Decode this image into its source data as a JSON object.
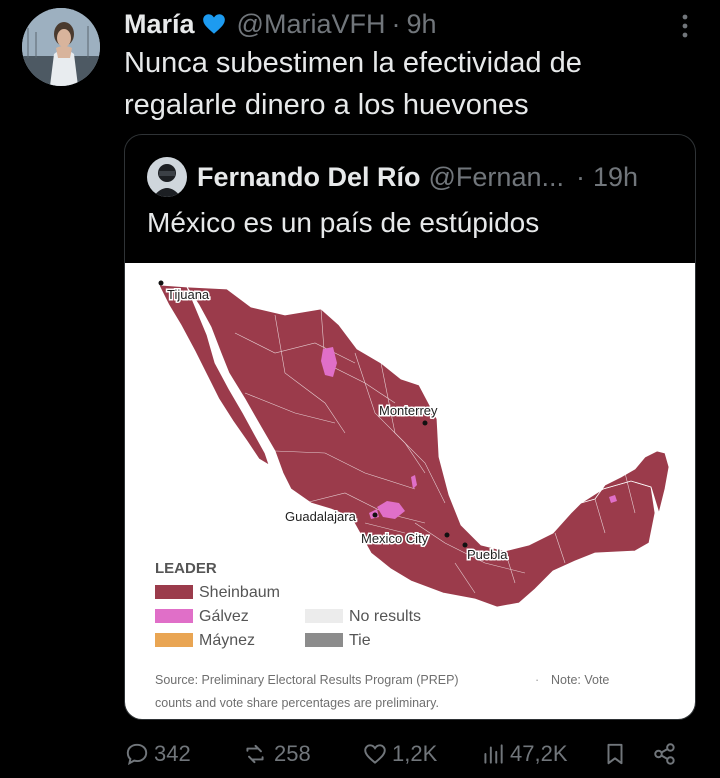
{
  "tweet": {
    "name": "María",
    "handle": "@MariaVFH",
    "separator": "·",
    "time": "9h",
    "text": "Nunca subestimen la efectividad de regalarle dinero a los huevones"
  },
  "quote": {
    "name": "Fernando Del Río",
    "handle": "@Fernan...",
    "separator": "·",
    "time": "19h",
    "text": "México es un país de estúpidos"
  },
  "map": {
    "cities": {
      "tijuana": "Tijuana",
      "monterrey": "Monterrey",
      "guadalajara": "Guadalajara",
      "mexico_city": "Mexico City",
      "puebla": "Puebla"
    },
    "legend": {
      "title": "LEADER",
      "sheinbaum": "Sheinbaum",
      "galvez": "Gálvez",
      "maynez": "Máynez",
      "no_results": "No results",
      "tie": "Tie"
    },
    "source_line1": "Source: Preliminary Electoral Results Program (PREP)",
    "bullet": "·",
    "note_line1": "Note: Vote",
    "source_line2": "counts and vote share percentages are preliminary.",
    "colors": {
      "sheinbaum": "#9b3b4b",
      "galvez": "#e06fc8",
      "maynez": "#e9a553",
      "no_results": "#ececec",
      "tie": "#8c8c8c"
    }
  },
  "actions": {
    "replies": "342",
    "retweets": "258",
    "likes": "1,2K",
    "views": "47,2K"
  },
  "colors": {
    "background": "#000000",
    "text": "#e7e9ea",
    "muted": "#71767b",
    "verified": "#1d9bf0"
  }
}
